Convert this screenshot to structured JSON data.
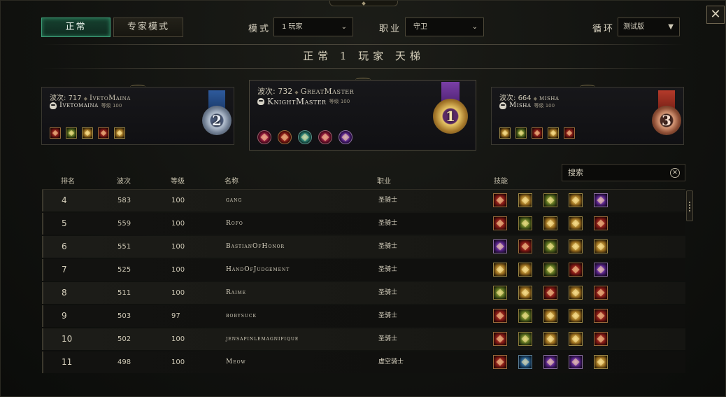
{
  "header": {
    "close_label": "✕"
  },
  "mode_tabs": [
    {
      "label": "正常",
      "active": true
    },
    {
      "label": "专家模式",
      "active": false
    }
  ],
  "filters": {
    "mode": {
      "label": "模式",
      "value": "1 玩家"
    },
    "class": {
      "label": "职业",
      "value": "守卫"
    },
    "cycle": {
      "label": "循环",
      "value": "测试版"
    }
  },
  "title": "正常 1 玩家 天梯",
  "podium": {
    "first": {
      "wave_label": "波次",
      "wave": "732",
      "account": "GreatMaster",
      "name": "KnightMaster",
      "level_label": "等级",
      "level": "100",
      "rank": "1",
      "skills": [
        "sk-crimson",
        "sk-red",
        "sk-teal",
        "sk-crimson",
        "sk-purple"
      ]
    },
    "second": {
      "wave_label": "波次",
      "wave": "717",
      "account": "IvetoMaina",
      "name": "Ivetomaina",
      "level_label": "等级",
      "level": "100",
      "rank": "2",
      "skills": [
        "sk-red",
        "sk-green",
        "sk-gold",
        "sk-red",
        "sk-gold"
      ]
    },
    "third": {
      "wave_label": "波次",
      "wave": "664",
      "account": "misha",
      "name": "Misha",
      "level_label": "等级",
      "level": "100",
      "rank": "3",
      "skills": [
        "sk-gold",
        "sk-green",
        "sk-red",
        "sk-gold",
        "sk-red"
      ]
    }
  },
  "search": {
    "placeholder": "搜索"
  },
  "table": {
    "headers": {
      "rank": "排名",
      "wave": "波次",
      "level": "等级",
      "name": "名称",
      "class": "职业",
      "skills": "技能"
    },
    "rows": [
      {
        "rank": "4",
        "wave": "583",
        "level": "100",
        "name": "gang",
        "class": "圣骑士",
        "skills": [
          "sk-red",
          "sk-gold",
          "sk-green",
          "sk-gold",
          "sk-purple"
        ]
      },
      {
        "rank": "5",
        "wave": "559",
        "level": "100",
        "name": "Rofo",
        "class": "圣骑士",
        "skills": [
          "sk-red",
          "sk-green",
          "sk-gold",
          "sk-gold",
          "sk-red"
        ]
      },
      {
        "rank": "6",
        "wave": "551",
        "level": "100",
        "name": "BastianOfHonor",
        "class": "圣骑士",
        "skills": [
          "sk-purple",
          "sk-red",
          "sk-green",
          "sk-gold",
          "sk-gold"
        ]
      },
      {
        "rank": "7",
        "wave": "525",
        "level": "100",
        "name": "HandOfJudgement",
        "class": "圣骑士",
        "skills": [
          "sk-gold",
          "sk-gold",
          "sk-green",
          "sk-red",
          "sk-purple"
        ]
      },
      {
        "rank": "8",
        "wave": "511",
        "level": "100",
        "name": "Raime",
        "class": "圣骑士",
        "skills": [
          "sk-green",
          "sk-gold",
          "sk-red",
          "sk-gold",
          "sk-red"
        ]
      },
      {
        "rank": "9",
        "wave": "503",
        "level": "97",
        "name": "bobysuck",
        "class": "圣骑士",
        "skills": [
          "sk-red",
          "sk-green",
          "sk-gold",
          "sk-gold",
          "sk-red"
        ]
      },
      {
        "rank": "10",
        "wave": "502",
        "level": "100",
        "name": "jensapinlemagnifique",
        "class": "圣骑士",
        "skills": [
          "sk-red",
          "sk-green",
          "sk-gold",
          "sk-gold",
          "sk-red"
        ]
      },
      {
        "rank": "11",
        "wave": "498",
        "level": "100",
        "name": "Meow",
        "class": "虚空骑士",
        "skills": [
          "sk-red",
          "sk-blue",
          "sk-purple",
          "sk-purple",
          "sk-gold"
        ]
      }
    ]
  },
  "colors": {
    "accent_green": "#3fa27b",
    "gold": "#c9a24a",
    "silver": "#9fb0c4",
    "bronze": "#b0603f"
  }
}
